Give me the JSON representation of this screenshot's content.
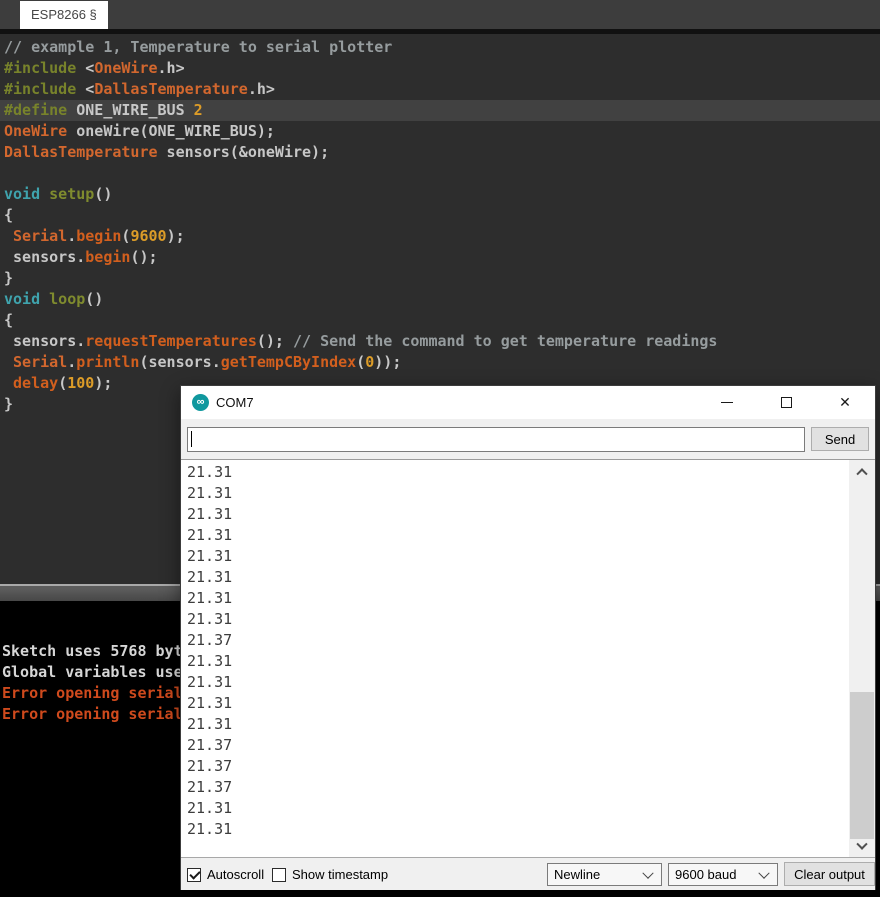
{
  "ide": {
    "tab_label": "ESP8266 §",
    "highlight_line": 3,
    "editor_lines": [
      [
        {
          "c": "cmt",
          "t": "// example 1, Temperature to serial plotter"
        }
      ],
      [
        {
          "c": "pp",
          "t": "#include"
        },
        {
          "c": "pln",
          "t": " <"
        },
        {
          "c": "lib",
          "t": "OneWire"
        },
        {
          "c": "pln",
          "t": ".h>"
        }
      ],
      [
        {
          "c": "pp",
          "t": "#include"
        },
        {
          "c": "pln",
          "t": " <"
        },
        {
          "c": "lib",
          "t": "DallasTemperature"
        },
        {
          "c": "pln",
          "t": ".h>"
        }
      ],
      [
        {
          "c": "pp",
          "t": "#define"
        },
        {
          "c": "pln",
          "t": " ONE_WIRE_BUS "
        },
        {
          "c": "num",
          "t": "2"
        }
      ],
      [
        {
          "c": "lib",
          "t": "OneWire"
        },
        {
          "c": "pln",
          "t": " oneWire(ONE_WIRE_BUS);"
        }
      ],
      [
        {
          "c": "lib",
          "t": "DallasTemperature"
        },
        {
          "c": "pln",
          "t": " sensors(&oneWire);"
        }
      ],
      [],
      [
        {
          "c": "typ",
          "t": "void"
        },
        {
          "c": "pln",
          "t": " "
        },
        {
          "c": "fn",
          "t": "setup"
        },
        {
          "c": "pln",
          "t": "()"
        }
      ],
      [
        {
          "c": "pln",
          "t": "{"
        }
      ],
      [
        {
          "c": "pln",
          "t": " "
        },
        {
          "c": "lib",
          "t": "Serial"
        },
        {
          "c": "pln",
          "t": "."
        },
        {
          "c": "fun",
          "t": "begin"
        },
        {
          "c": "pln",
          "t": "("
        },
        {
          "c": "num",
          "t": "9600"
        },
        {
          "c": "pln",
          "t": ");"
        }
      ],
      [
        {
          "c": "pln",
          "t": " sensors."
        },
        {
          "c": "fun",
          "t": "begin"
        },
        {
          "c": "pln",
          "t": "();"
        }
      ],
      [
        {
          "c": "pln",
          "t": "}"
        }
      ],
      [
        {
          "c": "typ",
          "t": "void"
        },
        {
          "c": "pln",
          "t": " "
        },
        {
          "c": "fn",
          "t": "loop"
        },
        {
          "c": "pln",
          "t": "()"
        }
      ],
      [
        {
          "c": "pln",
          "t": "{"
        }
      ],
      [
        {
          "c": "pln",
          "t": " sensors."
        },
        {
          "c": "fun",
          "t": "requestTemperatures"
        },
        {
          "c": "pln",
          "t": "(); "
        },
        {
          "c": "cmt",
          "t": "// Send the command to get temperature readings"
        }
      ],
      [
        {
          "c": "pln",
          "t": " "
        },
        {
          "c": "lib",
          "t": "Serial"
        },
        {
          "c": "pln",
          "t": "."
        },
        {
          "c": "fun",
          "t": "println"
        },
        {
          "c": "pln",
          "t": "(sensors."
        },
        {
          "c": "fun",
          "t": "getTempCByIndex"
        },
        {
          "c": "pln",
          "t": "("
        },
        {
          "c": "num",
          "t": "0"
        },
        {
          "c": "pln",
          "t": "));"
        }
      ],
      [
        {
          "c": "pln",
          "t": " "
        },
        {
          "c": "fun",
          "t": "delay"
        },
        {
          "c": "pln",
          "t": "("
        },
        {
          "c": "num",
          "t": "100"
        },
        {
          "c": "pln",
          "t": ");"
        }
      ],
      [
        {
          "c": "pln",
          "t": "}"
        }
      ]
    ],
    "console_lines": [
      {
        "text": "Sketch uses 5768 byt",
        "type": "info"
      },
      {
        "text": "Global variables use",
        "type": "info"
      },
      {
        "text": "Error opening serial",
        "type": "error"
      },
      {
        "text": "Error opening serial",
        "type": "error"
      }
    ]
  },
  "serial_monitor": {
    "title": "COM7",
    "app_icon_glyph": "∞",
    "input_value": "",
    "send_button_label": "Send",
    "values": [
      "21.31",
      "21.31",
      "21.31",
      "21.31",
      "21.31",
      "21.31",
      "21.31",
      "21.31",
      "21.37",
      "21.31",
      "21.31",
      "21.31",
      "21.31",
      "21.37",
      "21.37",
      "21.37",
      "21.31",
      "21.31"
    ],
    "autoscroll_label": "Autoscroll",
    "autoscroll_checked": true,
    "timestamp_label": "Show timestamp",
    "timestamp_checked": false,
    "line_ending_value": "Newline",
    "baud_value": "9600 baud",
    "clear_button_label": "Clear output"
  },
  "colors": {
    "accent_teal": "#10989e",
    "error_orange": "#cf4a1d",
    "editor_bg": "#2d2d2d",
    "keyword_olive": "#78832b",
    "library_orange": "#d2672e",
    "number_gold": "#dc9c28",
    "type_teal": "#3fa3ad"
  }
}
